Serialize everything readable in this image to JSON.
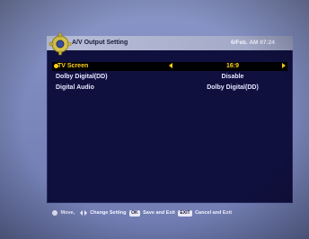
{
  "header": {
    "title": "A/V Output Setting",
    "clock": "6/Feb. AM 07:24",
    "icon": "gear-icon"
  },
  "settings": [
    {
      "label": "TV Screen",
      "value": "16:9"
    },
    {
      "label": "Dolby Digital(DD)",
      "value": "Disable"
    },
    {
      "label": "Digital Audio",
      "value": "Dolby Digital(DD)"
    }
  ],
  "footer": {
    "move": "Move,",
    "change": "Change Setting",
    "ok_key": "OK",
    "save": "Save and Exit",
    "exit_key": "EXIT",
    "cancel": "Cancel and Exit"
  },
  "colors": {
    "panel": "#10103f",
    "highlight_text": "#ffd21a",
    "background": "#7d89bd"
  }
}
